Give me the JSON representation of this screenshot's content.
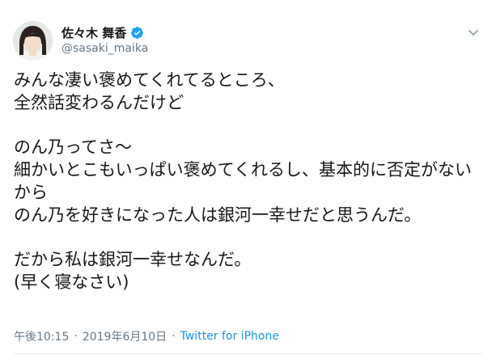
{
  "user": {
    "display_name": "佐々木 舞香",
    "handle": "@sasaki_maika",
    "verified_icon": "verified-badge-icon",
    "avatar_icon": "profile-photo"
  },
  "tweet": {
    "lines": [
      "みんな凄い褒めてくれてるところ、",
      "全然話変わるんだけど",
      "",
      "のん乃ってさ～",
      "細かいとこもいっぱい褒めてくれるし、基本的に否定がないから",
      "のん乃を好きになった人は銀河一幸せだと思うんだ。",
      "",
      "だから私は銀河一幸せなんだ。",
      "(早く寝なさい)"
    ],
    "time": "午後10:15",
    "separator": "·",
    "date": "2019年6月10日",
    "source": "Twitter for iPhone"
  },
  "colors": {
    "text": "#14171a",
    "secondary": "#657786",
    "link": "#1b95e0",
    "verified": "#1da1f2"
  },
  "icons": {
    "menu": "chevron-down-icon"
  }
}
